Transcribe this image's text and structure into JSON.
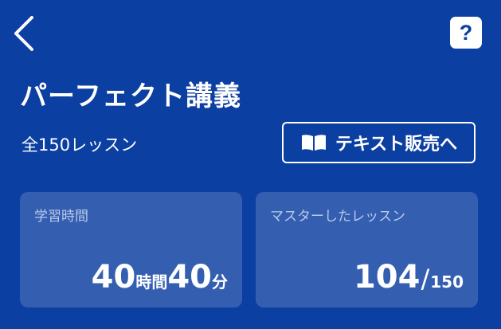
{
  "header": {
    "back_icon": "chevron-left-icon",
    "help_label": "?"
  },
  "course": {
    "title": "パーフェクト講義",
    "lesson_count": "全150レッスン"
  },
  "text_sales_button": {
    "icon": "book-icon",
    "label": "テキスト販売へ"
  },
  "stats": {
    "study_time": {
      "label": "学習時間",
      "hours": "40",
      "hours_unit": "時間",
      "minutes": "40",
      "minutes_unit": "分"
    },
    "mastered": {
      "label": "マスターしたレッスン",
      "count": "104",
      "separator": "/",
      "total": "150"
    }
  },
  "colors": {
    "background": "#0c3fa2",
    "card": "rgba(255,255,255,0.17)",
    "foreground": "#ffffff"
  }
}
